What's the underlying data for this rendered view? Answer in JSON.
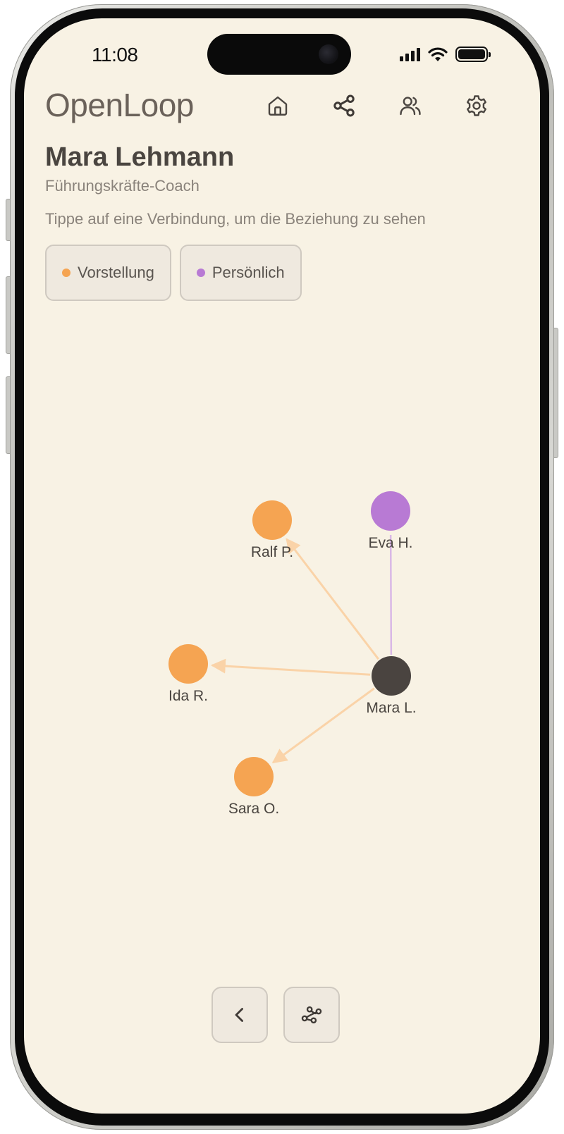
{
  "status_bar": {
    "time": "11:08",
    "icons": [
      "cellular-signal-icon",
      "wifi-icon",
      "battery-icon"
    ]
  },
  "app": {
    "logo": "OpenLoop",
    "nav": [
      {
        "id": "home",
        "icon": "home-icon"
      },
      {
        "id": "share",
        "icon": "share-network-icon"
      },
      {
        "id": "contacts",
        "icon": "users-icon"
      },
      {
        "id": "settings",
        "icon": "gear-icon"
      }
    ]
  },
  "profile": {
    "name": "Mara Lehmann",
    "role": "Führungskräfte-Coach"
  },
  "hint": "Tippe auf eine Verbindung, um die Beziehung zu sehen",
  "legend": [
    {
      "label": "Vorstellung",
      "color": "#f5a452"
    },
    {
      "label": "Persönlich",
      "color": "#b87ad4"
    }
  ],
  "graph": {
    "colors": {
      "center": "#4a4440",
      "introduction_node": "#f5a452",
      "introduction_edge": "#fad3a8",
      "personal_node": "#b87ad4",
      "personal_edge": "#d9b8e6",
      "label": "#4a4540"
    },
    "nodes": [
      {
        "id": "mara",
        "label": "Mara L.",
        "kind": "center"
      },
      {
        "id": "ralf",
        "label": "Ralf P.",
        "kind": "introduction"
      },
      {
        "id": "eva",
        "label": "Eva H.",
        "kind": "personal"
      },
      {
        "id": "ida",
        "label": "Ida R.",
        "kind": "introduction"
      },
      {
        "id": "sara",
        "label": "Sara O.",
        "kind": "introduction"
      }
    ],
    "edges": [
      {
        "from": "mara",
        "to": "ralf",
        "kind": "introduction",
        "directed": true
      },
      {
        "from": "mara",
        "to": "eva",
        "kind": "personal",
        "directed": false
      },
      {
        "from": "mara",
        "to": "ida",
        "kind": "introduction",
        "directed": true
      },
      {
        "from": "mara",
        "to": "sara",
        "kind": "introduction",
        "directed": true
      }
    ]
  },
  "bottom_controls": [
    {
      "id": "back",
      "icon": "chevron-left-icon"
    },
    {
      "id": "layout",
      "icon": "graph-layout-icon"
    }
  ]
}
